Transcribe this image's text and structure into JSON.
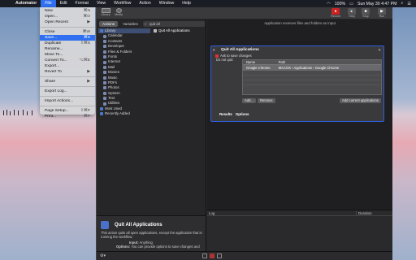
{
  "menubar": {
    "app": "Automator",
    "menus": [
      "File",
      "Edit",
      "Format",
      "View",
      "Workflow",
      "Action",
      "Window",
      "Help"
    ],
    "battery": "100%",
    "clock": "Sun May 30 4:47 PM"
  },
  "file_menu": {
    "items": [
      {
        "label": "New",
        "shortcut": "⌘N"
      },
      {
        "label": "Open...",
        "shortcut": "⌘O"
      },
      {
        "label": "Open Recent",
        "shortcut": "▶"
      },
      {
        "sep": true
      },
      {
        "label": "Close",
        "shortcut": "⌘W"
      },
      {
        "label": "Save...",
        "shortcut": "⌘S",
        "highlight": true
      },
      {
        "label": "Duplicate",
        "shortcut": "⇧⌘S"
      },
      {
        "label": "Rename...",
        "shortcut": ""
      },
      {
        "label": "Move To...",
        "shortcut": ""
      },
      {
        "label": "Convert To...",
        "shortcut": "⌥⌘E"
      },
      {
        "label": "Export...",
        "shortcut": ""
      },
      {
        "label": "Revert To",
        "shortcut": "▶"
      },
      {
        "sep": true
      },
      {
        "label": "Share",
        "shortcut": "▶"
      },
      {
        "sep": true
      },
      {
        "label": "Export Log...",
        "shortcut": ""
      },
      {
        "sep": true
      },
      {
        "label": "Import Actions...",
        "shortcut": ""
      },
      {
        "sep": true
      },
      {
        "label": "Page Setup...",
        "shortcut": "⇧⌘P"
      },
      {
        "label": "Print...",
        "shortcut": "⌘P"
      }
    ]
  },
  "toolbar": {
    "library": "Library",
    "media": "Media",
    "record": "Record",
    "step": "Step",
    "stop": "Stop",
    "run": "Run"
  },
  "library": {
    "tabs": [
      "Actions",
      "Variables"
    ],
    "search_value": "quit all",
    "tree": [
      {
        "label": "Library",
        "top": true,
        "selected": true
      },
      {
        "label": "Calendar"
      },
      {
        "label": "Contacts"
      },
      {
        "label": "Developer"
      },
      {
        "label": "Files & Folders"
      },
      {
        "label": "Fonts"
      },
      {
        "label": "Internet"
      },
      {
        "label": "Mail"
      },
      {
        "label": "Movies"
      },
      {
        "label": "Music"
      },
      {
        "label": "PDFs"
      },
      {
        "label": "Photos"
      },
      {
        "label": "System"
      },
      {
        "label": "Text"
      },
      {
        "label": "Utilities"
      },
      {
        "label": "Most Used",
        "top": true
      },
      {
        "label": "Recently Added",
        "top": true
      }
    ],
    "results": [
      "Quit All Applications"
    ]
  },
  "description": {
    "title": "Quit All Applications",
    "text": "This action quits all open applications, except the application that is running the workflow.",
    "input_label": "Input:",
    "input_value": "Anything",
    "options_label": "Options:",
    "options_value": "You can provide options to save changes and"
  },
  "workflow": {
    "header": "Application receives files and folders as input",
    "action": {
      "title": "Quit All Applications",
      "ask_label": "Ask to save changes",
      "donot_label": "Do not quit:",
      "columns": [
        "Name",
        "Path"
      ],
      "rows": [
        {
          "name": "Google Chrome",
          "path": "MACOS › Applications › Google Chrome"
        }
      ],
      "add_label": "Add...",
      "remove_label": "Remove",
      "add_current_label": "Add current applications",
      "tabs": [
        "Results",
        "Options"
      ]
    }
  },
  "log": {
    "columns": [
      "Log",
      "Duration"
    ]
  }
}
